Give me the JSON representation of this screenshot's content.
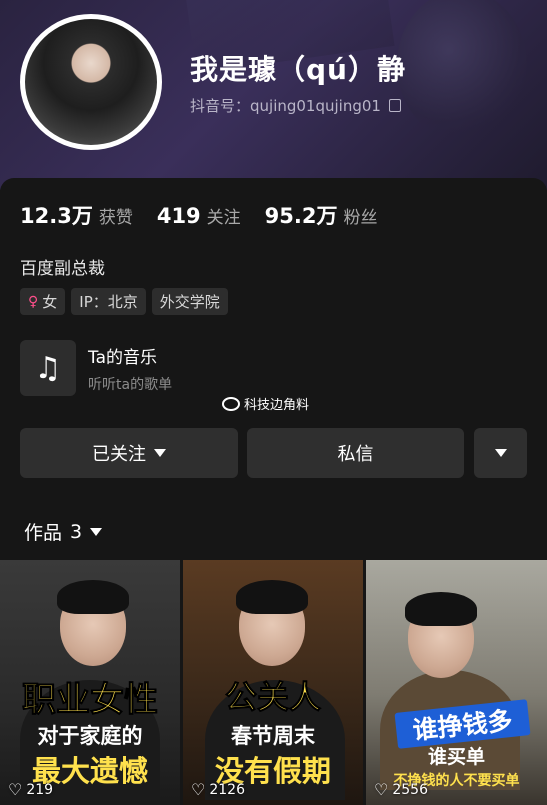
{
  "profile": {
    "nickname": "我是璩（qú）静",
    "douyin_id": "抖音号：qujing01qujing01"
  },
  "stats": [
    {
      "value": "12.3万",
      "label": "获赞"
    },
    {
      "value": "419",
      "label": "关注"
    },
    {
      "value": "95.2万",
      "label": "粉丝"
    }
  ],
  "bio": "百度副总裁",
  "tags": {
    "gender": "女",
    "ip": "IP：北京",
    "school": "外交学院"
  },
  "music": {
    "title": "Ta的音乐",
    "subtitle": "听听ta的歌单"
  },
  "watermark": "科技边角料",
  "buttons": {
    "followed": "已关注",
    "message": "私信"
  },
  "works": {
    "label": "作品",
    "count": "3"
  },
  "videos": [
    {
      "line1": "职业女性",
      "line2": "对于家庭的",
      "line3": "最大遗憾",
      "likes": "219"
    },
    {
      "line1": "公关人",
      "line2": "春节周末",
      "line3": "没有假期",
      "likes": "2126"
    },
    {
      "line1": "谁挣钱多",
      "line2": "谁买单",
      "line3": "不挣钱的人不要买单",
      "likes": "2556"
    }
  ],
  "colors": {
    "accent_yellow": "#ffe14d",
    "female_pink": "#ff4f8b",
    "panel_bg": "#161616"
  }
}
